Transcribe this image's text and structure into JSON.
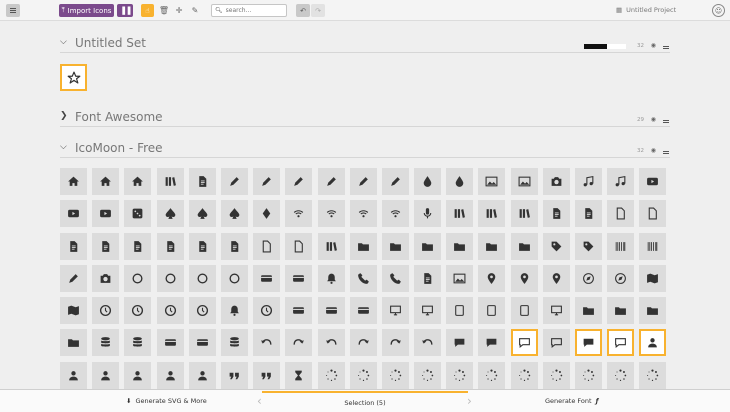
{
  "toolbar": {
    "import_label": "Import Icons",
    "search_placeholder": "search...",
    "project_name": "Untitled Project",
    "tools": [
      "select-icon",
      "trash-icon",
      "move-icon",
      "pencil-icon"
    ]
  },
  "sets": [
    {
      "name": "Untitled Set",
      "count": "32",
      "expanded": true,
      "fill_fraction": 0.55
    },
    {
      "name": "Font Awesome",
      "count": "29",
      "expanded": false
    },
    {
      "name": "IcoMoon - Free",
      "count": "32",
      "expanded": true
    }
  ],
  "grid": {
    "columns": 19,
    "selected_indices": [
      109,
      111,
      112,
      113
    ],
    "icons": [
      "home",
      "home2",
      "home3",
      "office",
      "newspaper",
      "pencil",
      "pencil2",
      "quill",
      "pen",
      "blog",
      "eyedropper",
      "droplet",
      "paint-format",
      "image",
      "images",
      "camera",
      "headphones",
      "music",
      "play",
      "film",
      "video-camera",
      "dice",
      "pacman",
      "spades",
      "clubs",
      "diamonds",
      "bullhorn",
      "connection",
      "podcast",
      "feed",
      "mic",
      "book",
      "books",
      "library",
      "file-text",
      "profile",
      "file-empty",
      "files-empty",
      "file-text2",
      "file-picture",
      "file-music",
      "file-play",
      "file-video",
      "file-zip",
      "copy",
      "paste",
      "stack",
      "folder",
      "folder-open",
      "folder-plus",
      "folder-minus",
      "folder-download",
      "folder-upload",
      "price-tag",
      "price-tags",
      "barcode",
      "qrcode",
      "ticket",
      "cart",
      "coin-dollar",
      "coin-euro",
      "coin-pound",
      "coin-yen",
      "credit-card",
      "calculator",
      "lifebuoy",
      "phone",
      "phone-hang-up",
      "address-book",
      "envelop",
      "pushpin",
      "location",
      "location2",
      "compass",
      "compass2",
      "map",
      "map2",
      "history",
      "clock",
      "clock2",
      "alarm",
      "bell",
      "stopwatch",
      "calendar",
      "printer",
      "keyboard",
      "display",
      "laptop",
      "mobile",
      "mobile2",
      "tablet",
      "tv",
      "drawer",
      "drawer2",
      "box-add",
      "box-remove",
      "download",
      "upload",
      "floppy-disk",
      "drive",
      "database",
      "undo",
      "redo",
      "undo2",
      "redo2",
      "forward",
      "reply",
      "bubble",
      "bubbles",
      "bubbles2",
      "bubble2",
      "bubbles3",
      "bubbles4",
      "user",
      "users",
      "user-plus",
      "user-minus",
      "user-check",
      "user-tie",
      "quotes-left",
      "quotes-right",
      "hour-glass",
      "spinner",
      "spinner2",
      "spinner3",
      "spinner4",
      "spinner5",
      "spinner6",
      "spinner7",
      "spinner8",
      "spinner9",
      "spinner10",
      "spinner11"
    ]
  },
  "bottombar": {
    "generate_svg": "Generate SVG & More",
    "selection": "Selection (5)",
    "generate_font": "Generate Font"
  },
  "colors": {
    "accent": "#f8b22f",
    "brand": "#7b4a8c",
    "tile": "#dcdcdc",
    "glyph": "#333333"
  }
}
